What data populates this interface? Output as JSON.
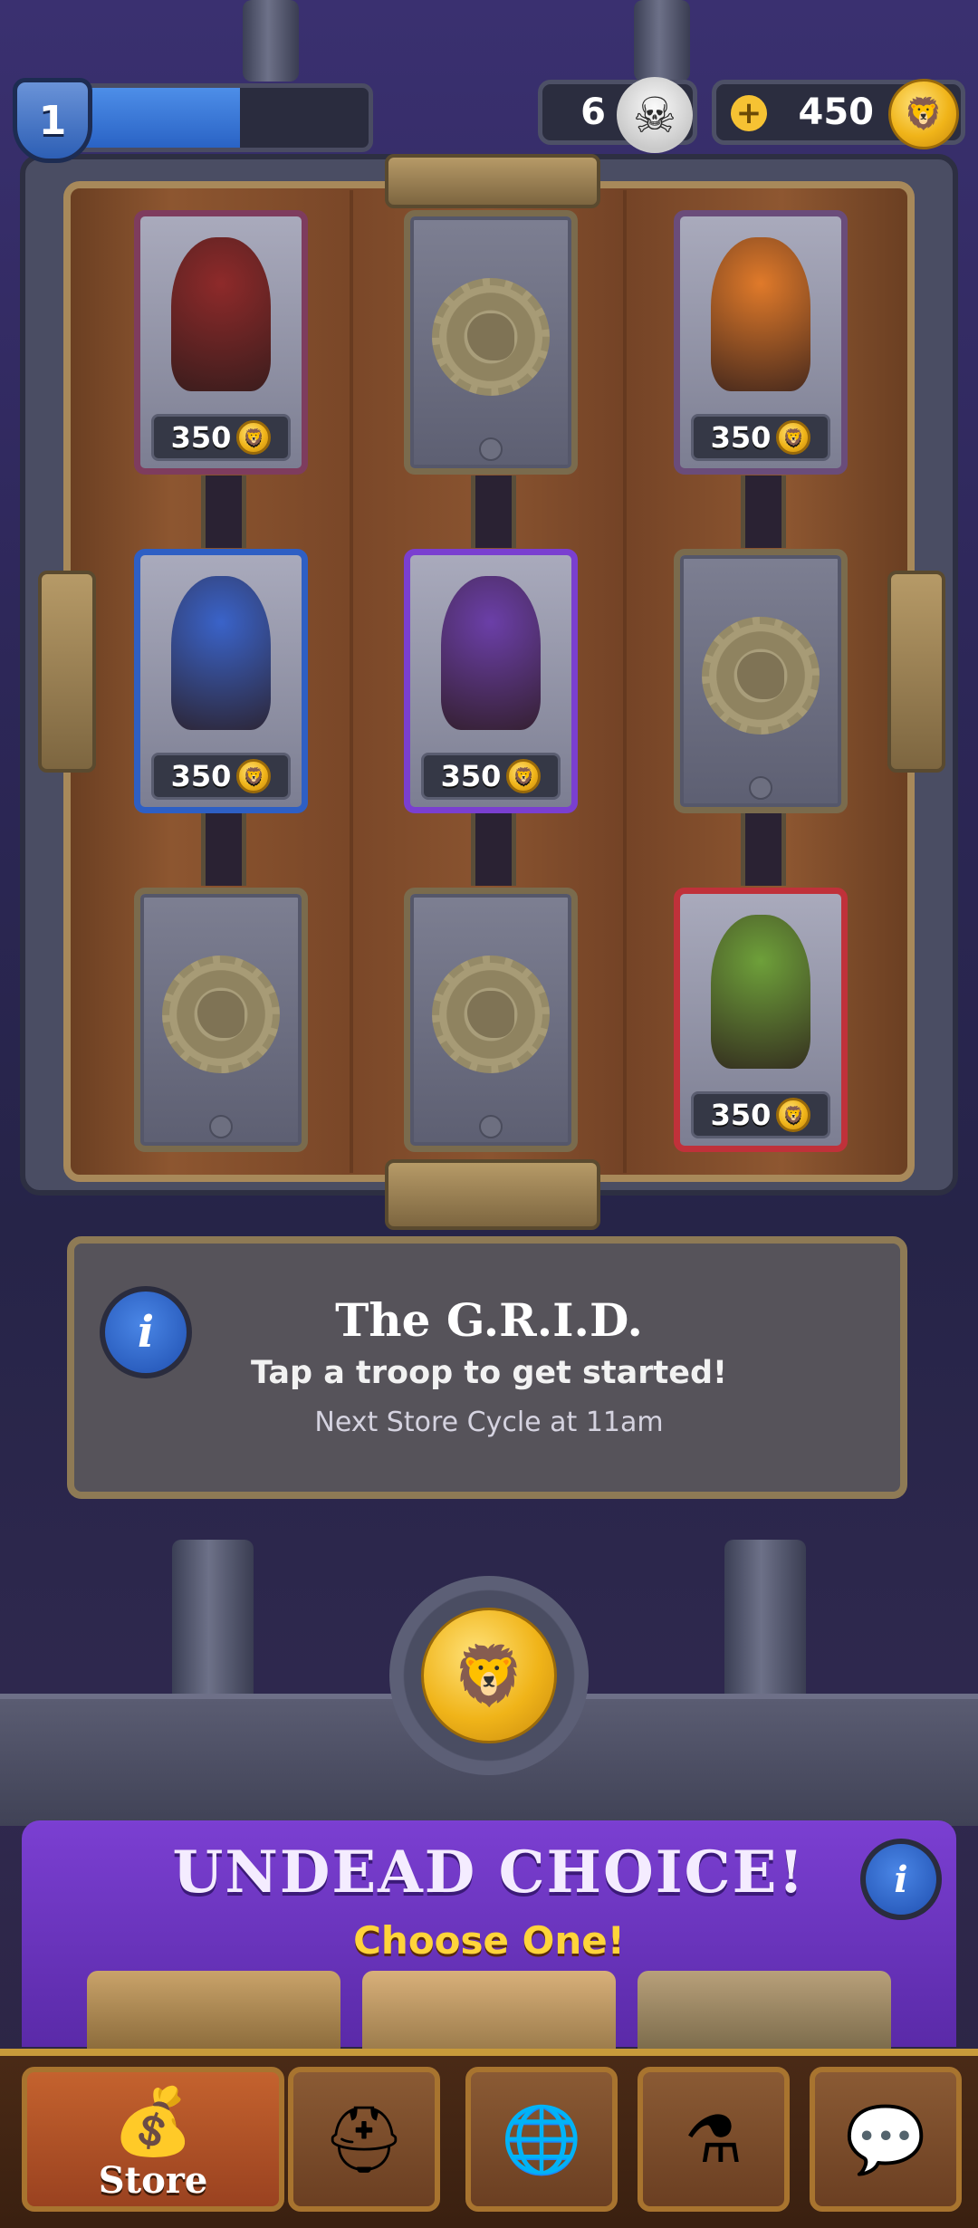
{
  "hud": {
    "level": "1",
    "xp_progress": 0.6,
    "skulls": "6",
    "gold": "450"
  },
  "grid": {
    "cards": [
      {
        "state": "troop",
        "price": "350",
        "border": "#7e3c5e",
        "art": "#8e2a2a",
        "icon": "sorceress-icon"
      },
      {
        "state": "locked",
        "icon": "gear-lion-icon"
      },
      {
        "state": "troop",
        "price": "350",
        "border": "#6a4c7a",
        "art": "#e07a2a",
        "icon": "demon-icon"
      },
      {
        "state": "troop",
        "price": "350",
        "border": "#2e5fc4",
        "art": "#3a63c9",
        "icon": "knight-shield-icon"
      },
      {
        "state": "troop",
        "price": "350",
        "border": "#7a3fd0",
        "art": "#6b3fa8",
        "icon": "skull-scythe-icon"
      },
      {
        "state": "locked",
        "icon": "gear-lion-icon"
      },
      {
        "state": "locked",
        "icon": "gear-lion-icon"
      },
      {
        "state": "locked",
        "icon": "gear-lion-icon"
      },
      {
        "state": "troop",
        "price": "350",
        "border": "#c0313a",
        "art": "#6ea03a",
        "icon": "orc-icon"
      }
    ]
  },
  "info": {
    "title": "The G.R.I.D.",
    "subtitle": "Tap a troop to get started!",
    "next_cycle": "Next Store Cycle at 11am"
  },
  "banner": {
    "title": "UNDEAD CHOICE!",
    "subtitle": "Choose One!"
  },
  "nav": {
    "items": [
      {
        "label": "Store",
        "icon": "chest-coins-icon",
        "active": true
      },
      {
        "label": "",
        "icon": "helmet-icon",
        "active": false
      },
      {
        "label": "",
        "icon": "globe-icon",
        "active": false
      },
      {
        "label": "",
        "icon": "potion-tower-icon",
        "active": false
      },
      {
        "label": "",
        "icon": "chat-scroll-icon",
        "active": false
      }
    ]
  },
  "colors": {
    "accent_purple": "#7b3fd2",
    "gold": "#f0b419",
    "wood": "#8d5630"
  }
}
